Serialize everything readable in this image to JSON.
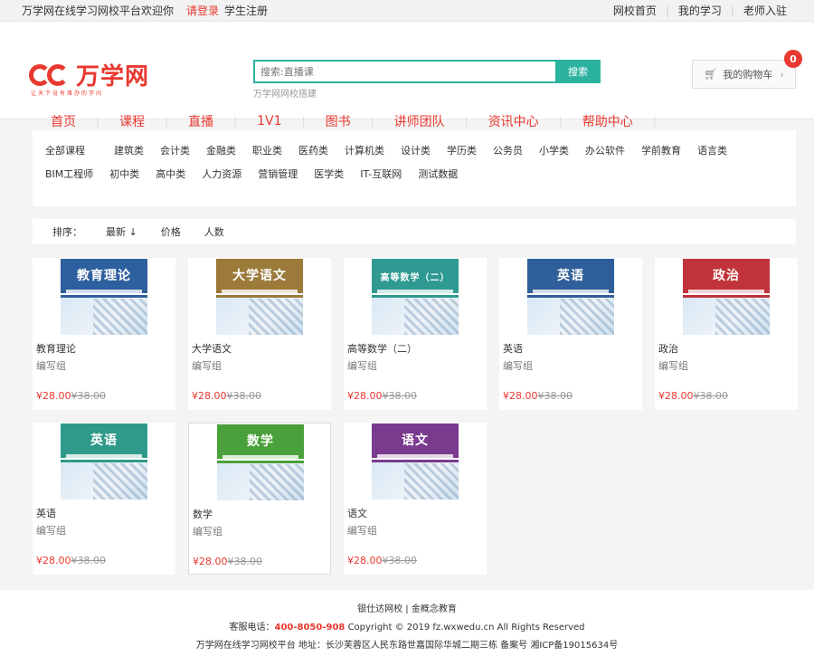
{
  "topbar": {
    "welcome": "万学网在线学习网校平台欢迎你",
    "login": "请登录",
    "register": "学生注册",
    "links": [
      "网校首页",
      "我的学习",
      "老师入驻"
    ]
  },
  "logo": {
    "name": "万学网",
    "slogan": "让天下没有难办的学问"
  },
  "search": {
    "placeholder": "搜索:直播课",
    "button": "搜索",
    "hint": "万学网网校搭建"
  },
  "cart": {
    "label": "我的购物车",
    "count": "0"
  },
  "nav": [
    "首页",
    "课程",
    "直播",
    "1V1",
    "图书",
    "讲师团队",
    "资讯中心",
    "帮助中心"
  ],
  "filter": {
    "all": "全部课程",
    "row1": [
      "建筑类",
      "会计类",
      "金融类",
      "职业类",
      "医药类",
      "计算机类",
      "设计类",
      "学历类",
      "公务员",
      "小学类",
      "办公软件",
      "学前教育",
      "语言类"
    ],
    "row2": [
      "BIM工程师",
      "初中类",
      "高中类",
      "人力资源",
      "营销管理",
      "医学类",
      "IT-互联网",
      "测试数据"
    ]
  },
  "sort": {
    "label": "排序：",
    "options": [
      "最新 ↓",
      "价格",
      "人数"
    ]
  },
  "books": [
    {
      "title": "教育理论",
      "cover_title": "教育理论",
      "author": "编写组",
      "price": "¥28.00",
      "old_price": "¥38.00",
      "color": "#2e5f9e"
    },
    {
      "title": "大学语文",
      "cover_title": "大学语文",
      "author": "编写组",
      "price": "¥28.00",
      "old_price": "¥38.00",
      "color": "#9b7a3a"
    },
    {
      "title": "高等数学（二）",
      "cover_title": "高等数学（二）",
      "author": "编写组",
      "price": "¥28.00",
      "old_price": "¥38.00",
      "color": "#2f9a92"
    },
    {
      "title": "英语",
      "cover_title": "英语",
      "author": "编写组",
      "price": "¥28.00",
      "old_price": "¥38.00",
      "color": "#2f5f9a"
    },
    {
      "title": "政治",
      "cover_title": "政治",
      "author": "编写组",
      "price": "¥28.00",
      "old_price": "¥38.00",
      "color": "#c0333a"
    },
    {
      "title": "英语",
      "cover_title": "英语",
      "author": "编写组",
      "price": "¥28.00",
      "old_price": "¥38.00",
      "color": "#2f9a8a"
    },
    {
      "title": "数学",
      "cover_title": "数学",
      "author": "编写组",
      "price": "¥28.00",
      "old_price": "¥38.00",
      "color": "#4aa03a"
    },
    {
      "title": "语文",
      "cover_title": "语文",
      "author": "编写组",
      "price": "¥28.00",
      "old_price": "¥38.00",
      "color": "#7a3a8e"
    }
  ],
  "footer": {
    "links": "银仕达网校 | 金概念教育",
    "phone_label": "客服电话：",
    "phone": "400-8050-908",
    "copyright": "Copyright © 2019 fz.wxwedu.cn All Rights Reserved",
    "address": "万学网在线学习网校平台 地址：长沙芙蓉区人民东路世嘉国际华城二期三栋 备案号 湘ICP备19015634号"
  }
}
